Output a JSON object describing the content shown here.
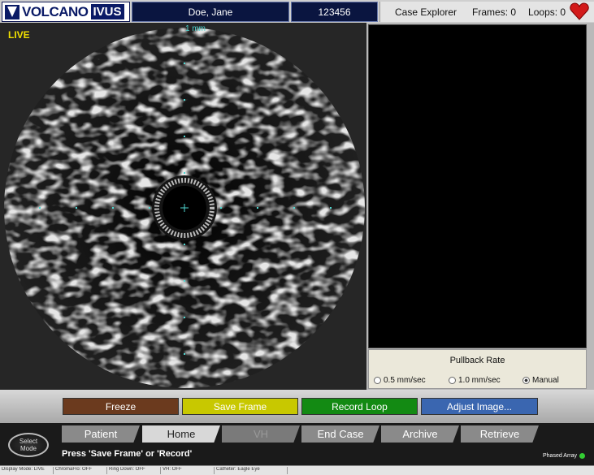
{
  "header": {
    "logo_text": "VOLCANO",
    "logo_suffix": "IVUS",
    "patient_name": "Doe, Jane",
    "patient_id": "123456",
    "case_explorer": "Case Explorer",
    "frames": "Frames: 0",
    "loops": "Loops: 0"
  },
  "image": {
    "mode": "LIVE",
    "scale": "1 mm"
  },
  "pullback": {
    "title": "Pullback Rate",
    "options": [
      "0.5 mm/sec",
      "1.0 mm/sec",
      "Manual"
    ],
    "selected": "Manual"
  },
  "actions": {
    "freeze": "Freeze",
    "save_frame": "Save Frame",
    "record_loop": "Record Loop",
    "adjust_image": "Adjust Image..."
  },
  "tabs": [
    "Patient",
    "Home",
    "VH",
    "End Case",
    "Archive",
    "Retrieve"
  ],
  "select_mode": {
    "line1": "Select",
    "line2": "Mode"
  },
  "status_message": "Press 'Save Frame' or 'Record'",
  "phased_array": "Phased Array",
  "status_strip": [
    "Display Mode: LIVE",
    "ChromaFlo: OFF",
    "Ring Down: OFF",
    "VH: OFF",
    "Catheter: Eagle Eye"
  ],
  "colors": {
    "freeze": "#6b3a1e",
    "save_frame": "#c8c800",
    "record_loop": "#138a13",
    "adjust_image": "#3a66b0"
  }
}
